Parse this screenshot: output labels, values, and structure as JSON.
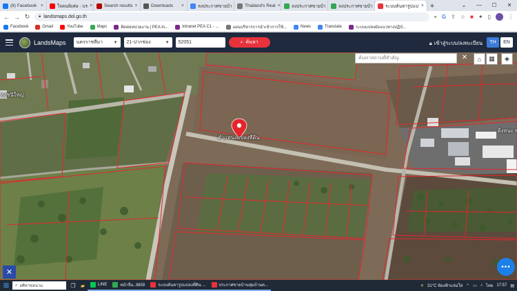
{
  "browser": {
    "tabs": [
      {
        "label": "(8) Facebook",
        "color": "#1877f2"
      },
      {
        "label": "ใจคนพิเศษ - บร",
        "color": "#ff0000"
      },
      {
        "label": "Search results",
        "color": "#b30000"
      },
      {
        "label": "Downloads",
        "color": "#555555"
      },
      {
        "label": "ลงประกาศขายบ้า",
        "color": "#4285f4"
      },
      {
        "label": "Thailand's Real",
        "color": "#777777"
      },
      {
        "label": "ลงประกาศขายบ้า",
        "color": "#34a853"
      },
      {
        "label": "ลงประกาศขายบ้า",
        "color": "#34a853"
      },
      {
        "label": "ระบบค้นหารูปแป",
        "color": "#e8323c",
        "active": true
      }
    ],
    "url": "landsmaps.dol.go.th",
    "bookmarks": [
      {
        "label": "Facebook",
        "color": "#1877f2"
      },
      {
        "label": "Gmail",
        "color": "#d93025"
      },
      {
        "label": "YouTube",
        "color": "#ff0000"
      },
      {
        "label": "Maps",
        "color": "#34a853"
      },
      {
        "label": "ติดต่อหน่วยงาน | PEA In...",
        "color": "#7b2a8b"
      },
      {
        "label": "Intranet PEA C1 - ...",
        "color": "#7b2a8b"
      },
      {
        "label": "แผนบริหารการนำเข้าการใช้...",
        "color": "#777777"
      },
      {
        "label": "News",
        "color": "#4285f4"
      },
      {
        "label": "Translate",
        "color": "#4285f4"
      },
      {
        "label": "ระบบแปลงผังแนวทางปฏิบั...",
        "color": "#7b2a8b"
      }
    ]
  },
  "app": {
    "brand": "LandsMaps",
    "province": "นครราชสีมา",
    "district": "21-ปากช่อง",
    "parcel_no": "52051",
    "search_label": "ค้นหา",
    "login_label": "เข้าสู่ระบบ/ลงทะเบียน",
    "lang_th": "TH",
    "lang_en": "EN"
  },
  "map": {
    "search_placeholder": "ค้นหาสถานที่สำคัญ",
    "marker_label": "ตำแหน่งแปลงที่ดิน",
    "place_left": "หอชนีใหญ่",
    "place_right": "ดิงทนะ พ",
    "fab_label": "•••"
  },
  "taskbar": {
    "search_placeholder": "อศิหาขอนาม",
    "tasks": [
      {
        "label": "LINE",
        "color": "#06c755"
      },
      {
        "label": "หน้าจีน..3659",
        "color": "#34a853"
      },
      {
        "label": "ระบบค้นหารูปแปลงที่ดิน ...",
        "color": "#e8323c"
      },
      {
        "label": "ประกาศขายบ้านหุ่มบ้านต...",
        "color": "#e8323c"
      }
    ],
    "weather": "31°C ท้องฟ้าแจ่มใส",
    "lang": "ไทย",
    "time": "17:57"
  }
}
